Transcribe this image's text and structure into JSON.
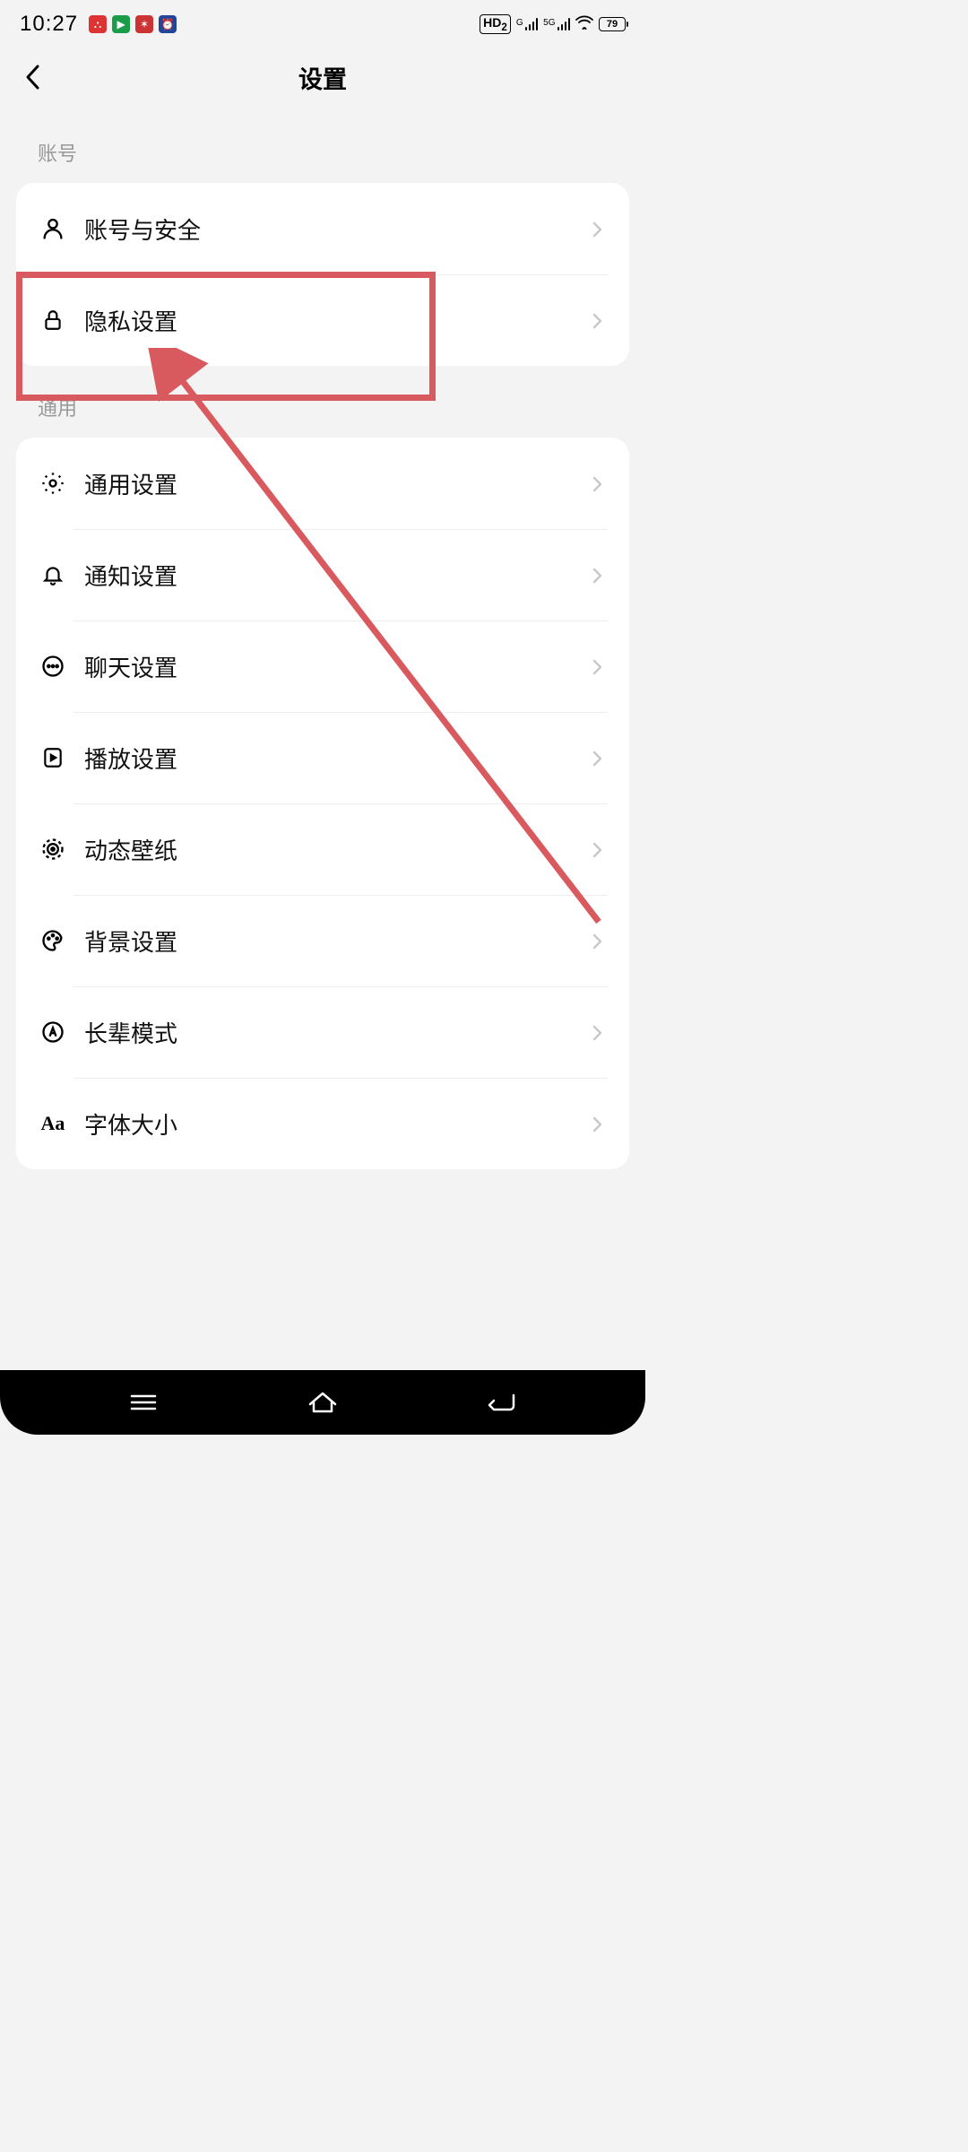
{
  "status": {
    "time": "10:27",
    "hd_label": "HD",
    "hd_sub": "2",
    "net1": "G",
    "net2": "5G",
    "battery": "79"
  },
  "header": {
    "title": "设置"
  },
  "sections": [
    {
      "title": "账号"
    },
    {
      "title": "通用"
    }
  ],
  "account_items": [
    {
      "label": "账号与安全"
    },
    {
      "label": "隐私设置"
    }
  ],
  "general_items": [
    {
      "label": "通用设置"
    },
    {
      "label": "通知设置"
    },
    {
      "label": "聊天设置"
    },
    {
      "label": "播放设置"
    },
    {
      "label": "动态壁纸"
    },
    {
      "label": "背景设置"
    },
    {
      "label": "长辈模式"
    },
    {
      "label": "字体大小"
    }
  ],
  "annotation": {
    "highlight_color": "#d85a5f"
  }
}
